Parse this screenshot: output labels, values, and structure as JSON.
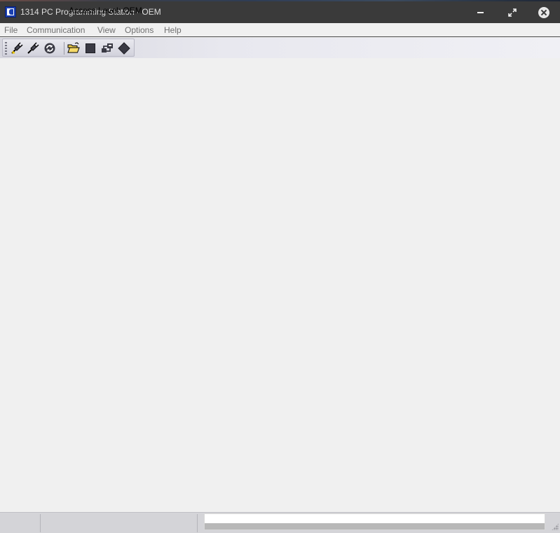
{
  "window": {
    "title": "1314 PC Programming Station - OEM",
    "controls": [
      "minimize-icon",
      "restore-icon",
      "close-icon"
    ]
  },
  "menu": {
    "file": "File",
    "communication": "Communication",
    "view": "View",
    "options": "Options",
    "help": "Help"
  },
  "toolbar": {
    "buttons": [
      {
        "icon": "connect-icon"
      },
      {
        "icon": "disconnect-icon"
      },
      {
        "icon": "refresh-icon"
      },
      {
        "icon": "open-folder-icon"
      },
      {
        "icon": "stop-icon"
      },
      {
        "icon": "network-icon"
      },
      {
        "icon": "diamond-icon"
      }
    ]
  },
  "status": {
    "access_level": "Access Level: OEM",
    "progress": 1.0
  },
  "colors": {
    "titlebar": "#3a3a3a",
    "client_background": "#f0f0f0",
    "status_background": "#d4d4d8"
  }
}
